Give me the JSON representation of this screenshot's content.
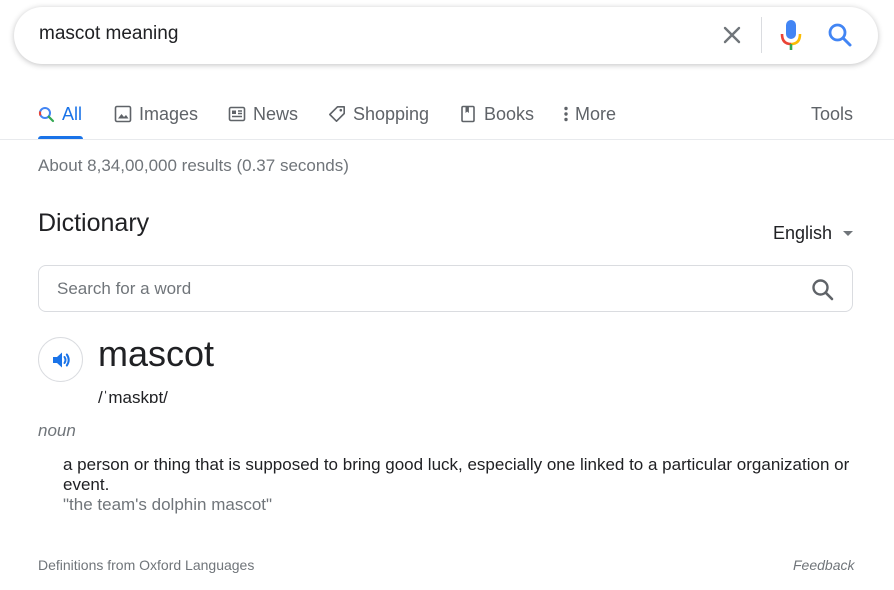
{
  "search": {
    "query": "mascot meaning"
  },
  "tabs": [
    {
      "label": "All",
      "icon": "search-icon",
      "active": true
    },
    {
      "label": "Images",
      "icon": "image-icon"
    },
    {
      "label": "News",
      "icon": "newspaper-icon"
    },
    {
      "label": "Shopping",
      "icon": "tag-icon"
    },
    {
      "label": "Books",
      "icon": "book-icon"
    },
    {
      "label": "More",
      "icon": "more-vert-icon"
    }
  ],
  "tools_label": "Tools",
  "result_stats": "About 8,34,00,000 results (0.37 seconds)",
  "dictionary": {
    "heading": "Dictionary",
    "language": "English",
    "search_placeholder": "Search for a word",
    "word": "mascot",
    "phonetic": "/ˈmaskɒt/",
    "part_of_speech": "noun",
    "definition": "a person or thing that is supposed to bring good luck, especially one linked to a particular organization or event.",
    "example": "\"the team's dolphin mascot\"",
    "source": "Definitions from Oxford Languages",
    "feedback": "Feedback"
  },
  "colors": {
    "accent": "#1a73e8",
    "muted_text": "#70757a",
    "tab_text": "#5f6368",
    "google_red": "#ea4335",
    "google_yellow": "#fbbc04",
    "google_green": "#34a853"
  }
}
